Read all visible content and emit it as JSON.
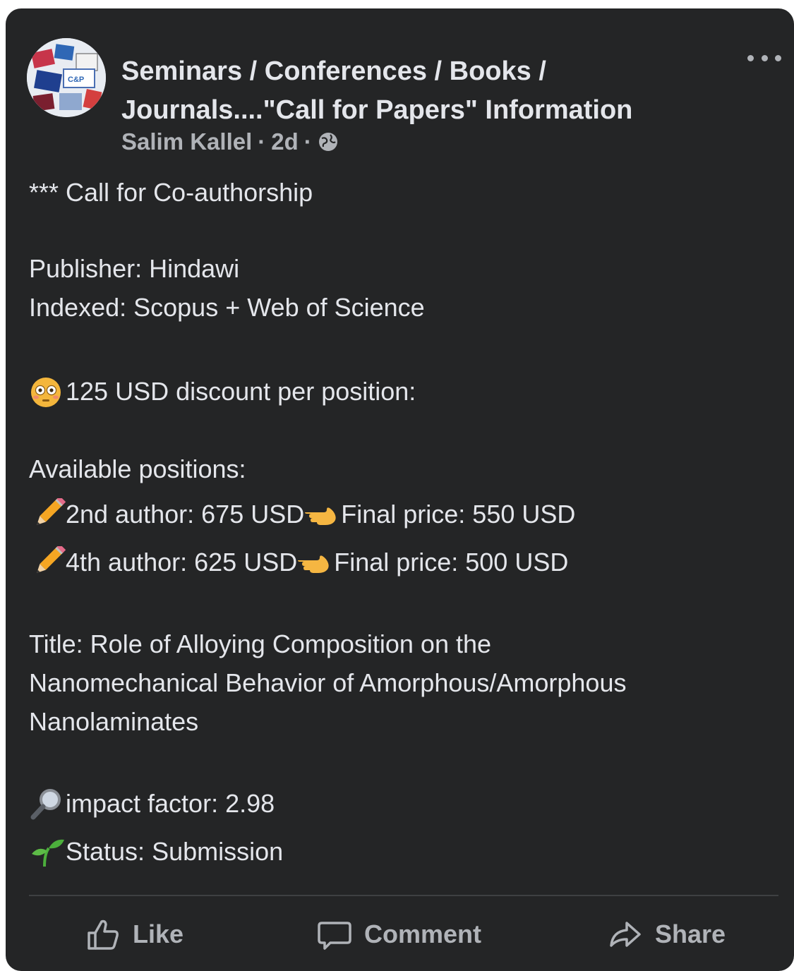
{
  "post": {
    "group_name": "Seminars / Conferences / Books /\nJournals....\"Call for Papers\"  Information",
    "author": "Salim Kallel",
    "separator": "·",
    "time": "2d",
    "visibility_icon": "globe-icon",
    "more_icon": "more-options-icon",
    "body": {
      "headline": "*** Call for Co-authorship",
      "publisher": "Publisher: Hindawi",
      "indexed": "Indexed: Scopus + Web of Science",
      "discount": "125 USD discount per position:",
      "available": "Available positions:",
      "position_2nd": {
        "left": "2nd author: 675 USD",
        "right": " Final price: 550 USD"
      },
      "position_4th": {
        "left": "4th author: 625 USD",
        "right": " Final price: 500 USD"
      },
      "title_line1": "Title: Role of Alloying Composition on the",
      "title_line2": "Nanomechanical Behavior of Amorphous/Amorphous",
      "title_line3": "Nanolaminates",
      "impact_factor": "impact factor: 2.98",
      "status": "Status: Submission"
    }
  },
  "actions": {
    "like": "Like",
    "comment": "Comment",
    "share": "Share"
  },
  "colors": {
    "background": "#242526",
    "text": "#e4e6eb",
    "secondary": "#b0b3b8"
  }
}
